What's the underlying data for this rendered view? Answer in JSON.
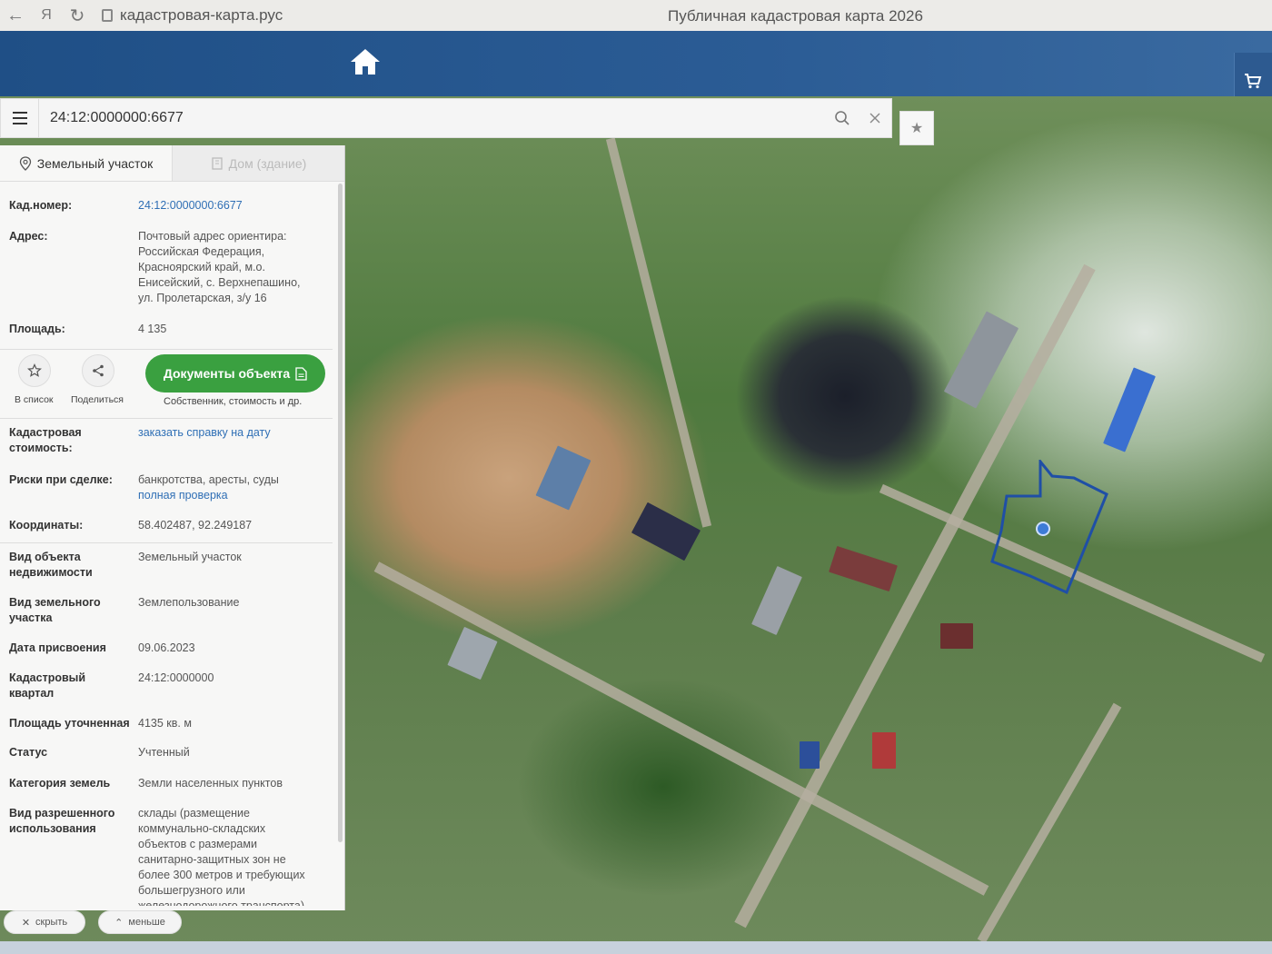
{
  "browser": {
    "url": "кадастровая-карта.рус",
    "title": "Публичная кадастровая карта 2026"
  },
  "search": {
    "value": "24:12:0000000:6677"
  },
  "tabs": {
    "land": "Земельный участок",
    "house": "Дом (здание)"
  },
  "info": {
    "kad_number_label": "Кад.номер:",
    "kad_number_value": "24:12:0000000:6677",
    "address_label": "Адрес:",
    "address_lines": [
      "Почтовый адрес ориентира:",
      "Российская Федерация,",
      "Красноярский край, м.о.",
      "Енисейский, с. Верхнепашино,",
      "ул. Пролетарская, з/у 16"
    ],
    "area_label": "Площадь:",
    "area_value": "4 135",
    "cad_cost_label": "Кадастровая стоимость:",
    "cad_cost_value": "заказать справку на дату",
    "risks_label": "Риски при сделке:",
    "risks_value": "банкротства, аресты, суды",
    "risks_link": "полная проверка",
    "coords_label": "Координаты:",
    "coords_value": "58.402487, 92.249187",
    "object_type_label": "Вид объекта недвижимости",
    "object_type_value": "Земельный участок",
    "land_type_label": "Вид земельного участка",
    "land_type_value": "Землепользование",
    "date_label": "Дата присвоения",
    "date_value": "09.06.2023",
    "quarter_label": "Кадастровый квартал",
    "quarter_value": "24:12:0000000",
    "precise_area_label": "Площадь уточненная",
    "precise_area_value": "4135 кв. м",
    "status_label": "Статус",
    "status_value": "Учтенный",
    "category_label": "Категория земель",
    "category_value": "Земли населенных пунктов",
    "permitted_use_label": "Вид разрешенного использования",
    "permitted_use_lines": [
      "склады (размещение",
      "коммунально-складских",
      "объектов с размерами",
      "санитарно-защитных зон не",
      "более 300 метров и требующих",
      "большегрузного или",
      "железнодорожного транспорта)"
    ]
  },
  "actions": {
    "add_to_list": "В список",
    "share": "Поделиться",
    "docs_button": "Документы объекта",
    "docs_sub": "Собственник, стоимость и др."
  },
  "bottom": {
    "hide": "скрыть",
    "less": "меньше"
  }
}
